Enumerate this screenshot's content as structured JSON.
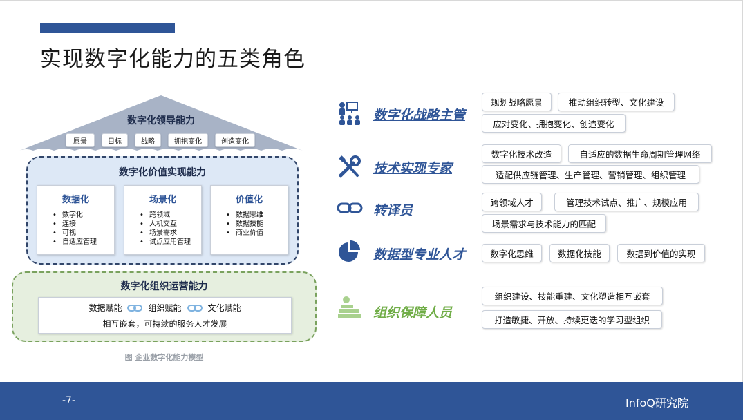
{
  "title": "实现数字化能力的五类角色",
  "model": {
    "leadership": {
      "title": "数字化领导能力",
      "tags": [
        "愿景",
        "目标",
        "战略",
        "拥抱变化",
        "创造变化"
      ]
    },
    "value": {
      "title": "数字化价值实现能力",
      "cards": [
        {
          "title": "数据化",
          "items": [
            "数字化",
            "连接",
            "可视",
            "自适应管理"
          ]
        },
        {
          "title": "场景化",
          "items": [
            "跨领域",
            "人机交互",
            "场景需求",
            "试点应用管理"
          ]
        },
        {
          "title": "价值化",
          "items": [
            "数据思维",
            "数据技能",
            "商业价值"
          ]
        }
      ]
    },
    "org": {
      "title": "数字化组织运营能力",
      "items": [
        "数据赋能",
        "组织赋能",
        "文化赋能"
      ],
      "subtitle": "相互嵌套，可持续的服务人才发展"
    },
    "caption": "图 企业数字化能力模型"
  },
  "roles": [
    {
      "name": "数字化战略主管",
      "icon": "presenter-icon",
      "tags": [
        "规划战略愿景",
        "推动组织转型、文化建设",
        "应对变化、拥抱变化、创造变化"
      ]
    },
    {
      "name": "技术实现专家",
      "icon": "tools-icon",
      "tags": [
        "数字化技术改造",
        "自适应的数据生命周期管理网络",
        "适配供应链管理、生产管理、营销管理、组织管理"
      ]
    },
    {
      "name": "转译员",
      "icon": "link-icon",
      "tags": [
        "跨领域人才",
        "管理技术试点、推广、规模应用",
        "场景需求与技术能力的匹配"
      ]
    },
    {
      "name": "数据型专业人才",
      "icon": "pie-chart-icon",
      "tags": [
        "数字化思维",
        "数据化技能",
        "数据到价值的实现"
      ]
    },
    {
      "name": "组织保障人员",
      "icon": "books-icon",
      "tags": [
        "组织建设、技能重建、文化塑造相互嵌套",
        "打造敏捷、开放、持续更迭的学习型组织"
      ]
    }
  ],
  "footer": {
    "page": "-7-",
    "brand": "InfoQ研究院"
  },
  "colors": {
    "accent": "#2f5597",
    "value_bg": "#dde8f6",
    "org_bg": "#e6efdf",
    "roof": "#a8b3c6"
  }
}
